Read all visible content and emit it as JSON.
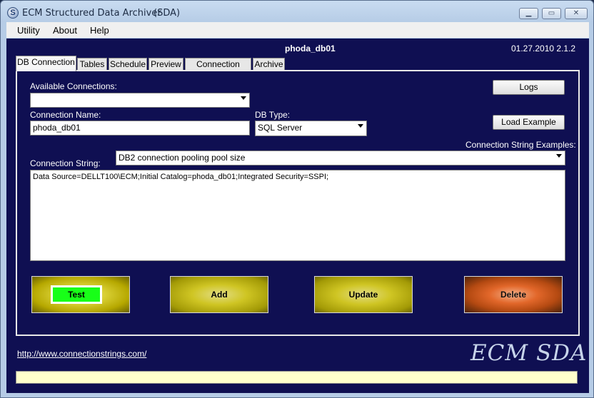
{
  "window": {
    "title": "ECM Structured Data Archiver",
    "subtitle": "(SDA)",
    "icon": "app-logo-icon",
    "controls": {
      "minimize": "▁",
      "maximize": "▭",
      "close": "✕"
    }
  },
  "menu": {
    "items": [
      "Utility",
      "About",
      "Help"
    ]
  },
  "header": {
    "db_name": "phoda_db01",
    "version": "01.27.2010 2.1.2"
  },
  "tabs": [
    "DB Connection",
    "Tables",
    "Schedule",
    "Preview",
    "Connection String",
    "Archive"
  ],
  "form": {
    "available_connections_label": "Available Connections:",
    "available_connections_value": "",
    "connection_name_label": "Connection Name:",
    "connection_name_value": "phoda_db01",
    "db_type_label": "DB Type:",
    "db_type_value": "SQL Server",
    "cs_examples_label": "Connection String Examples:",
    "cs_examples_value": "DB2 connection pooling pool size",
    "connection_string_label": "Connection String:",
    "connection_string_value": "Data Source=DELLT100\\ECM;Initial Catalog=phoda_db01;Integrated Security=SSPI;"
  },
  "buttons": {
    "logs": "Logs",
    "load_example": "Load Example",
    "test": "Test",
    "add": "Add",
    "update": "Update",
    "delete": "Delete"
  },
  "footer": {
    "link": "http://www.connectionstrings.com/",
    "brand": "ECM SDA",
    "status": ""
  },
  "colors": {
    "client_bg": "#0f0f52",
    "test_indicator": "#18ff18",
    "status_bg": "#ffffcc"
  }
}
